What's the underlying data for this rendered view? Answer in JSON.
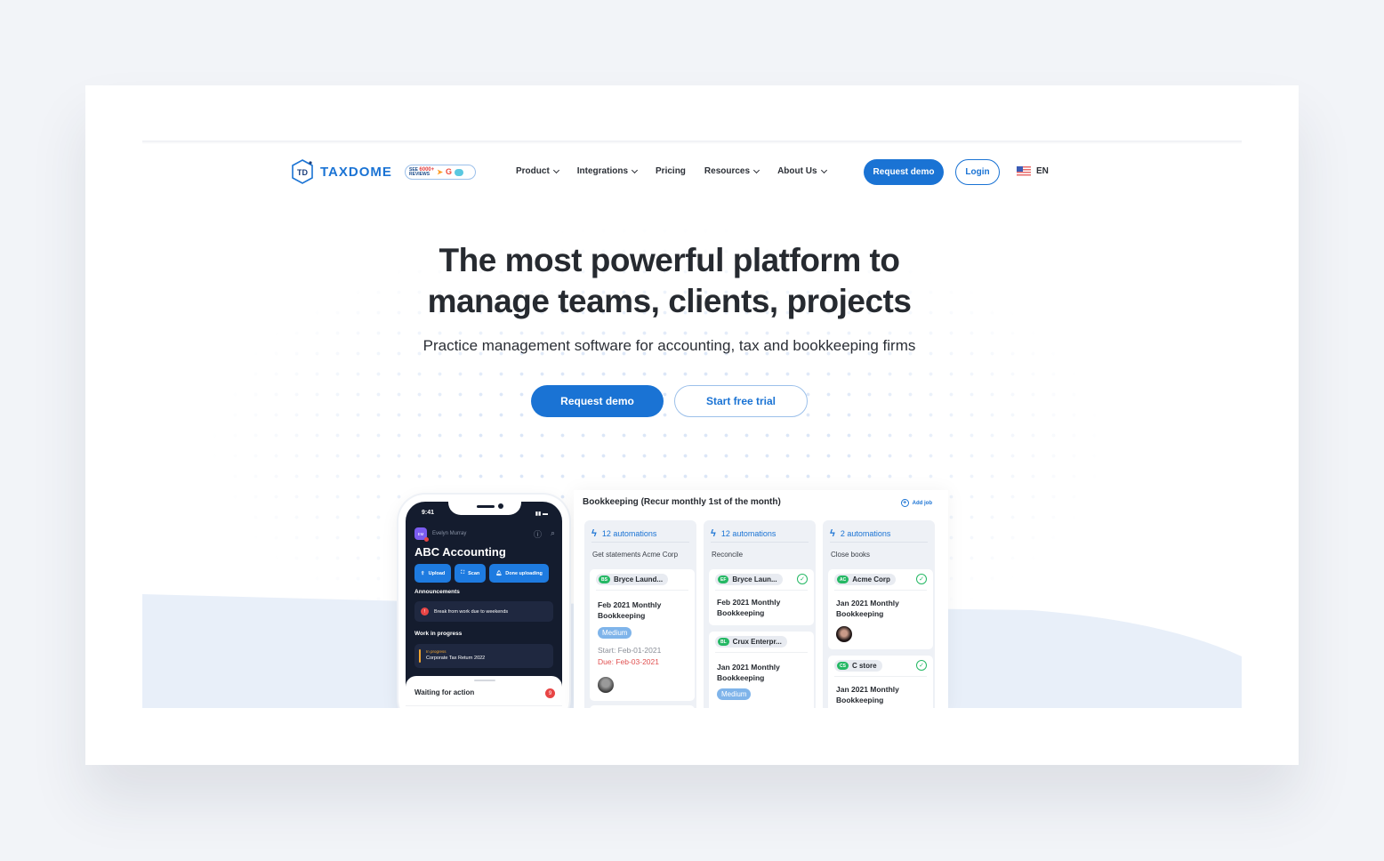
{
  "brand": {
    "logo_mark": "TD",
    "name": "TAXDOME",
    "reviews_badge": {
      "line1": "SEE",
      "count": "6000+",
      "line2": "REVIEWS"
    }
  },
  "nav": {
    "items": [
      {
        "label": "Product",
        "has_dropdown": true
      },
      {
        "label": "Integrations",
        "has_dropdown": true
      },
      {
        "label": "Pricing",
        "has_dropdown": false
      },
      {
        "label": "Resources",
        "has_dropdown": true
      },
      {
        "label": "About Us",
        "has_dropdown": true
      }
    ],
    "request_demo": "Request demo",
    "login": "Login",
    "language": "EN"
  },
  "hero": {
    "title_line1": "The most powerful platform to",
    "title_line2": "manage teams, clients, projects",
    "subtitle": "Practice management software for accounting, tax and bookkeeping firms",
    "primary_cta": "Request demo",
    "secondary_cta": "Start free trial"
  },
  "phone": {
    "time": "9:41",
    "user_initials": "EM",
    "user_name": "Evelyn Murray",
    "company": "ABC Accounting",
    "actions": [
      "Upload",
      "Scan",
      "Done uploading"
    ],
    "announcements_label": "Announcements",
    "announcement": "Break from work due to weekends",
    "wip_label": "Work in progress",
    "wip_status": "In progress",
    "wip_item": "Corporate Tax Return 2022",
    "waiting_label": "Waiting for action",
    "waiting_count": "9"
  },
  "board": {
    "title": "Bookkeeping (Recur monthly 1st of the month)",
    "add_job": "Add job",
    "columns": [
      {
        "automations": "12 automations",
        "task": "Get statements Acme Corp",
        "cards": [
          {
            "initials": "BS",
            "client": "Bryce Laund...",
            "done": false,
            "job": "Feb 2021 Monthly Bookkeeping",
            "priority": "Medium",
            "start": "Start: Feb-01-2021",
            "due": "Due: Feb-03-2021",
            "has_avatar": true
          }
        ]
      },
      {
        "automations": "12 automations",
        "task": "Reconcile",
        "cards": [
          {
            "initials": "EF",
            "client": "Bryce Laun...",
            "done": true,
            "job": "Feb 2021 Monthly Bookkeeping"
          },
          {
            "initials": "BL",
            "client": "Crux Enterpr...",
            "done": false,
            "job": "Jan 2021 Monthly Bookkeeping",
            "priority": "Medium"
          }
        ]
      },
      {
        "automations": "2 automations",
        "task": "Close books",
        "cards": [
          {
            "initials": "AC",
            "client": "Acme Corp",
            "done": true,
            "job": "Jan 2021 Monthly Bookkeeping",
            "has_avatar": true
          },
          {
            "initials": "CS",
            "client": "C store",
            "done": true,
            "job": "Jan 2021 Monthly Bookkeeping"
          }
        ]
      }
    ]
  },
  "colors": {
    "brand_blue": "#1a73d4",
    "success_green": "#25b864",
    "danger_red": "#e05050",
    "phone_dark": "#141c2e"
  }
}
